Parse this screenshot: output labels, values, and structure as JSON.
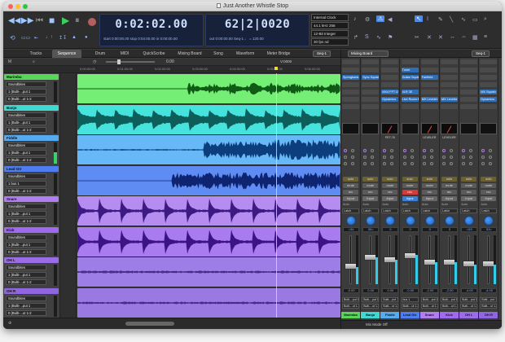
{
  "window": {
    "title": "Just Another Whistle Stop"
  },
  "transport": {
    "counter_main": "0:02:02.00",
    "counter_bars": "62|2|0020",
    "counter_sub_left": "start 0:00:00.00   stop 0:04:00.00   in 0:00:00.00",
    "counter_sub_right": "out 0:00:00.00   Seq-1   ♩ = 120.00",
    "sync": [
      "Internal Clock",
      "44.1 kHz  256",
      "12-Bit Integer",
      "30 fps nd"
    ]
  },
  "tabs": [
    "Tracks",
    "Sequence",
    "Drum",
    "MIDI",
    "QuickScribe",
    "Mixing Board",
    "Song",
    "Waveform",
    "Meter Bridge"
  ],
  "active_tab": "Sequence",
  "seq_selector": "Seq-1",
  "seq_toolbar": {
    "zoom_value": "0.00",
    "play_counter": "V:0000"
  },
  "ruler": [
    "0:00:00:00",
    "0:01:00:00",
    "0:02:00:00",
    "0:03:00:00",
    "0:04:00:00",
    "0:05:00:00",
    "0:06:00:00"
  ],
  "tracks": [
    {
      "name": "Marimba",
      "color": "#57d657",
      "wave_color": "#0f5a14",
      "lane_color": "#74ee74",
      "input": "Soundbites",
      "fields": [
        "1 (Bulti-...put 1",
        "0 (Bulti-...ut 1-2"
      ],
      "meter": false
    },
    {
      "name": "Banjo",
      "color": "#3fd9d2",
      "wave_color": "#0d5e5a",
      "lane_color": "#45e3dc",
      "input": "Soundbites",
      "fields": [
        "1 (Bulti-...put 1",
        "0 (Bulti-...ut 1-2"
      ],
      "meter": false
    },
    {
      "name": "Fiddle",
      "color": "#56aaf0",
      "wave_color": "#0c3d7c",
      "lane_color": "#66b8f6",
      "input": "Soundbites",
      "fields": [
        "1 (Bulti-...put 1",
        "0 (Bulti-...ut 1-2"
      ],
      "meter": true
    },
    {
      "name": "Lead Gtr",
      "color": "#4d7df0",
      "wave_color": "#0f2470",
      "lane_color": "#5e8cf3",
      "input": "Soundbites",
      "fields": [
        "1 bus 1",
        "0 (Bulti-...ut 1-2"
      ],
      "meter": false
    },
    {
      "name": "Snare",
      "color": "#b07ef0",
      "wave_color": "#3c1a82",
      "lane_color": "#b58cef",
      "input": "Soundbites",
      "fields": [
        "1 (Bulti-...put 1",
        "0 (Bulti-...ut 1-2"
      ],
      "meter": false
    },
    {
      "name": "Kick",
      "color": "#a06af0",
      "wave_color": "#3c1382",
      "lane_color": "#a87cee",
      "input": "Soundbites",
      "fields": [
        "1 (Bulti-...put 1",
        "0 (Bulti-...ut 1-2"
      ],
      "meter": false
    },
    {
      "name": "OH L",
      "color": "#9b6ce8",
      "wave_color": "#4a2a8a",
      "lane_color": "#9c7ee6",
      "input": "Soundbites",
      "fields": [
        "1 (Bulti-...put 1",
        "0 (Bulti-...ut 1-2"
      ],
      "meter": false
    },
    {
      "name": "OH R",
      "color": "#8f66e0",
      "wave_color": "#4a2a8a",
      "lane_color": "#9a7ae2",
      "input": "Soundbites",
      "fields": [
        "1 (Bulti-...put 1",
        "0 (Bulti-...ut 1-2"
      ],
      "meter": false
    }
  ],
  "mixer": {
    "title": "Mixing Board",
    "seq": "Seq-1",
    "footer": "Mix Mode Off",
    "strips": [
      {
        "name": "Marimba",
        "color": "#57d657",
        "inserts": [
          "",
          "Springbank...",
          "",
          "",
          "",
          ""
        ],
        "plugin": "",
        "input_on": false,
        "rec_on": false,
        "pan": "<34",
        "db": "-0.00",
        "level": 0.35,
        "out": "Bulti-...put 1",
        "out2": "Bulti-...ut 1-2"
      },
      {
        "name": "Banjo",
        "color": "#3fd9d2",
        "inserts": [
          "",
          "Sync Squish",
          "",
          "",
          "",
          ""
        ],
        "plugin": "",
        "input_on": false,
        "rec_on": false,
        "pan": "30>",
        "db": "0.00",
        "level": 0.55,
        "out": "Bulti-...put 1",
        "out2": "Bulti-...ut 1-2"
      },
      {
        "name": "Fiddle",
        "color": "#56aaf0",
        "inserts": [
          "",
          "",
          "",
          "MX4 FFT IZ",
          "Dynamics",
          ""
        ],
        "plugin": "FET-76",
        "input_on": false,
        "rec_on": false,
        "pan": "0",
        "db": "0.00",
        "level": 0.5,
        "out": "Bulti-...put 1",
        "out2": "Bulti-...ut 1-2"
      },
      {
        "name": "Lead Gtr",
        "color": "#4d7df0",
        "inserts": [
          "Tuner",
          "Guitar Squish",
          "",
          "4LR 3E",
          "Live Room B",
          ""
        ],
        "plugin": "",
        "input_on": true,
        "rec_on": true,
        "pan": "0",
        "db": "-0.00",
        "level": 0.6,
        "out": "bus 1",
        "out2": "Bulti-...ut 1-2"
      },
      {
        "name": "Snare",
        "color": "#b07ef0",
        "inserts": [
          "",
          "Fairfield",
          "",
          "",
          "MX Leveler",
          ""
        ],
        "plugin": "LEVELER",
        "input_on": false,
        "rec_on": false,
        "pan": "0",
        "db": "-2.00",
        "level": 0.45,
        "out": "Bulti-...put 1",
        "out2": "Bulti-...ut 1-2"
      },
      {
        "name": "Kick",
        "color": "#a06af0",
        "inserts": [
          "",
          "",
          "",
          "",
          "MX Leveler",
          ""
        ],
        "plugin": "LEVELER",
        "input_on": false,
        "rec_on": false,
        "pan": "0",
        "db": "-2.00",
        "level": 0.45,
        "out": "Bulti-...put 1",
        "out2": "Bulti-...ut 1-2"
      },
      {
        "name": "OH L",
        "color": "#9b6ce8",
        "inserts": [
          "",
          "",
          "",
          "",
          "",
          ""
        ],
        "plugin": "",
        "input_on": false,
        "rec_on": false,
        "pan": "<53",
        "db": "-4.00",
        "level": 0.4,
        "out": "Bulti-...put 1",
        "out2": "Bulti-...ut 1-2"
      },
      {
        "name": "OH R",
        "color": "#8f66e0",
        "inserts": [
          "",
          "",
          "",
          "MX Squish",
          "Dynamics",
          ""
        ],
        "plugin": "",
        "input_on": false,
        "rec_on": false,
        "pan": "53>",
        "db": "-4.00",
        "level": 0.4,
        "out": "Bulti-...put 1",
        "out2": "Bulti-...ut 1-2"
      }
    ]
  },
  "labels": {
    "solo": "solo",
    "mute": "mute",
    "rec": "rec",
    "input": "Input",
    "auto": "Auto",
    "latch": "Latch"
  },
  "icons": [
    "rewind-icon",
    "fast-forward-icon",
    "stop-icon",
    "play-icon",
    "pause-icon",
    "record-icon",
    "loop-icon",
    "metronome-icon",
    "arrow-tool-icon",
    "pencil-tool-icon",
    "scissors-tool-icon"
  ]
}
